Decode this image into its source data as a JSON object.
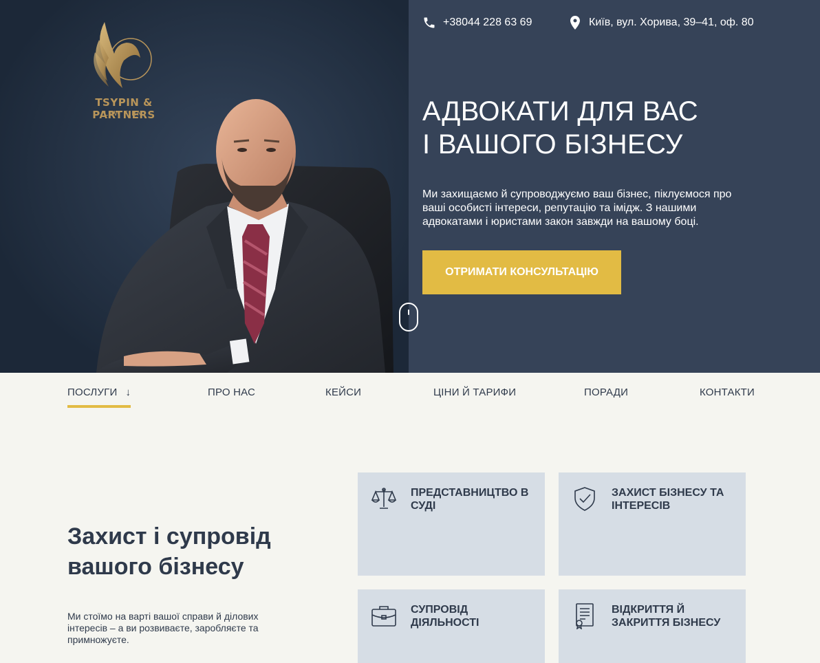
{
  "header": {
    "phone": "+38044 228 63 69",
    "address": "Київ, вул. Хорива, 39–41, оф. 80",
    "logo_name": "TSYPIN & PARTNERS",
    "logo_sub": "LAW FIRM"
  },
  "hero": {
    "title_line1": "АДВОКАТИ ДЛЯ ВАС",
    "title_line2": "І ВАШОГО БІЗНЕСУ",
    "text": "Ми захищаємо й супроводжуємо ваш бізнес, піклуємося про ваші особисті інтереси, репутацію та імідж. З нашими адвокатами і юристами закон завжди на вашому боці.",
    "cta": "ОТРИМАТИ КОНСУЛЬТАЦІЮ"
  },
  "nav": {
    "items": [
      {
        "label": "ПОСЛУГИ",
        "arrow": "↓"
      },
      {
        "label": "ПРО НАС"
      },
      {
        "label": "КЕЙСИ"
      },
      {
        "label": "ЦІНИ Й ТАРИФИ"
      },
      {
        "label": "ПОРАДИ"
      },
      {
        "label": "КОНТАКТИ"
      }
    ]
  },
  "services": {
    "title": "Захист і супровід вашого бізнесу",
    "text": "Ми стоїмо на варті вашої справи й ділових інтересів – а ви розвиваєте, заробляєте та примножуєте.",
    "cards": [
      {
        "label": "ПРЕДСТАВНИЦТВО В СУДІ",
        "icon": "scales-icon"
      },
      {
        "label": "ЗАХИСТ БІЗНЕСУ ТА ІНТЕРЕСІВ",
        "icon": "shield-check-icon"
      },
      {
        "label": "СУПРОВІД ДІЯЛЬНОСТІ",
        "icon": "briefcase-icon"
      },
      {
        "label": "ВІДКРИТТЯ Й ЗАКРИТТЯ БІЗНЕСУ",
        "icon": "certificate-icon"
      }
    ]
  },
  "colors": {
    "accent": "#e2bb44",
    "hero_dark": "#1d2a3b",
    "hero_panel": "#364358",
    "card_bg": "#d6dde5",
    "text": "#2f3a4b",
    "logo_gold": "#b8955a"
  }
}
